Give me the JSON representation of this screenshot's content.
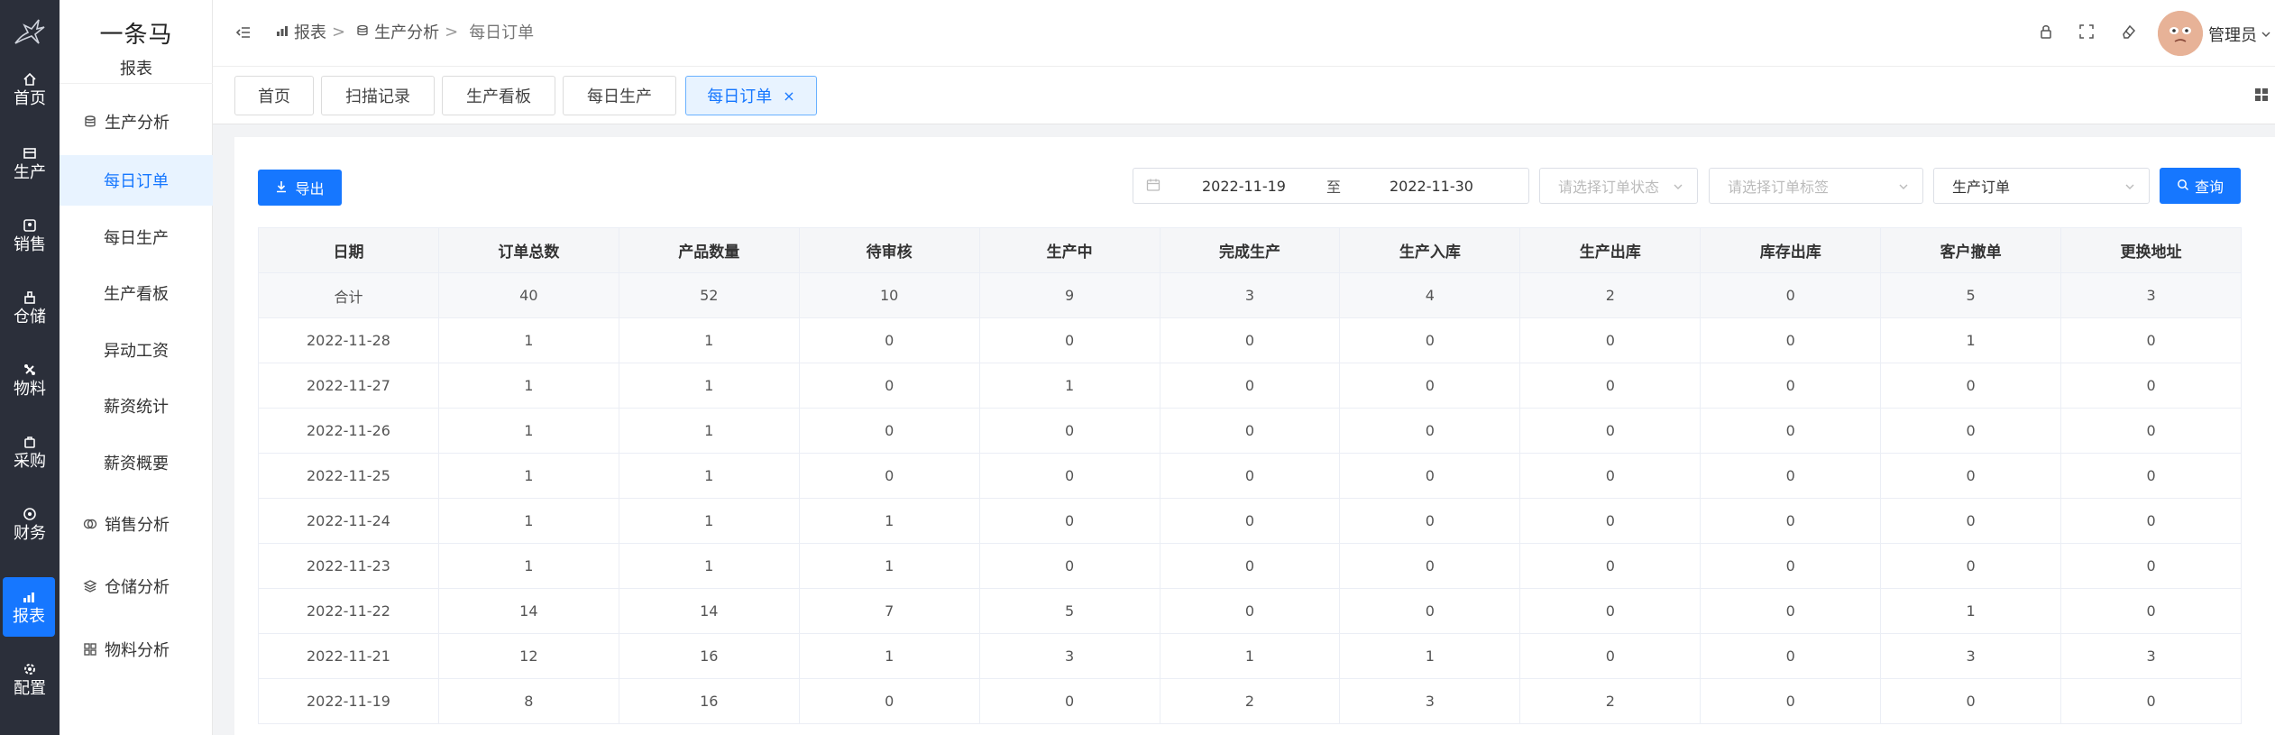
{
  "rail": {
    "items": [
      {
        "label": "首页",
        "icon": "home-icon"
      },
      {
        "label": "生产",
        "icon": "production-icon"
      },
      {
        "label": "销售",
        "icon": "sales-icon"
      },
      {
        "label": "仓储",
        "icon": "warehouse-icon"
      },
      {
        "label": "物料",
        "icon": "material-icon"
      },
      {
        "label": "采购",
        "icon": "purchase-icon"
      },
      {
        "label": "财务",
        "icon": "finance-icon"
      },
      {
        "label": "报表",
        "icon": "report-icon",
        "active": true
      },
      {
        "label": "配置",
        "icon": "settings-icon"
      }
    ]
  },
  "sidebar": {
    "brand": "一条马",
    "subtitle": "报表",
    "groups": {
      "production_analysis": "生产分析",
      "sales_analysis": "销售分析",
      "warehouse_analysis": "仓储分析",
      "material_analysis": "物料分析"
    },
    "items": [
      "每日订单",
      "每日生产",
      "生产看板",
      "异动工资",
      "薪资统计",
      "薪资概要"
    ],
    "active_item": "每日订单"
  },
  "header": {
    "breadcrumb": [
      "报表",
      "生产分析",
      "每日订单"
    ],
    "breadcrumb_sep": ">",
    "user": "管理员"
  },
  "tabs": [
    "首页",
    "扫描记录",
    "生产看板",
    "每日生产",
    "每日订单"
  ],
  "active_tab": "每日订单",
  "toolbar": {
    "export_label": "导出",
    "date_start": "2022-11-19",
    "date_to": "至",
    "date_end": "2022-11-30",
    "status_placeholder": "请选择订单状态",
    "tag_placeholder": "请选择订单标签",
    "order_type_value": "生产订单",
    "query_label": "查询"
  },
  "table": {
    "columns": [
      "日期",
      "订单总数",
      "产品数量",
      "待审核",
      "生产中",
      "完成生产",
      "生产入库",
      "生产出库",
      "库存出库",
      "客户撤单",
      "更换地址"
    ],
    "total_row": [
      "合计",
      "40",
      "52",
      "10",
      "9",
      "3",
      "4",
      "2",
      "0",
      "5",
      "3"
    ],
    "rows": [
      [
        "2022-11-28",
        "1",
        "1",
        "0",
        "0",
        "0",
        "0",
        "0",
        "0",
        "1",
        "0"
      ],
      [
        "2022-11-27",
        "1",
        "1",
        "0",
        "1",
        "0",
        "0",
        "0",
        "0",
        "0",
        "0"
      ],
      [
        "2022-11-26",
        "1",
        "1",
        "0",
        "0",
        "0",
        "0",
        "0",
        "0",
        "0",
        "0"
      ],
      [
        "2022-11-25",
        "1",
        "1",
        "0",
        "0",
        "0",
        "0",
        "0",
        "0",
        "0",
        "0"
      ],
      [
        "2022-11-24",
        "1",
        "1",
        "1",
        "0",
        "0",
        "0",
        "0",
        "0",
        "0",
        "0"
      ],
      [
        "2022-11-23",
        "1",
        "1",
        "1",
        "0",
        "0",
        "0",
        "0",
        "0",
        "0",
        "0"
      ],
      [
        "2022-11-22",
        "14",
        "14",
        "7",
        "5",
        "0",
        "0",
        "0",
        "0",
        "1",
        "0"
      ],
      [
        "2022-11-21",
        "12",
        "16",
        "1",
        "3",
        "1",
        "1",
        "0",
        "0",
        "3",
        "3"
      ],
      [
        "2022-11-19",
        "8",
        "16",
        "0",
        "0",
        "2",
        "3",
        "2",
        "0",
        "0",
        "0"
      ]
    ]
  },
  "colors": {
    "accent": "#1677ff",
    "rail_bg": "#2b2f3a",
    "active_bg": "#e8f3ff"
  }
}
